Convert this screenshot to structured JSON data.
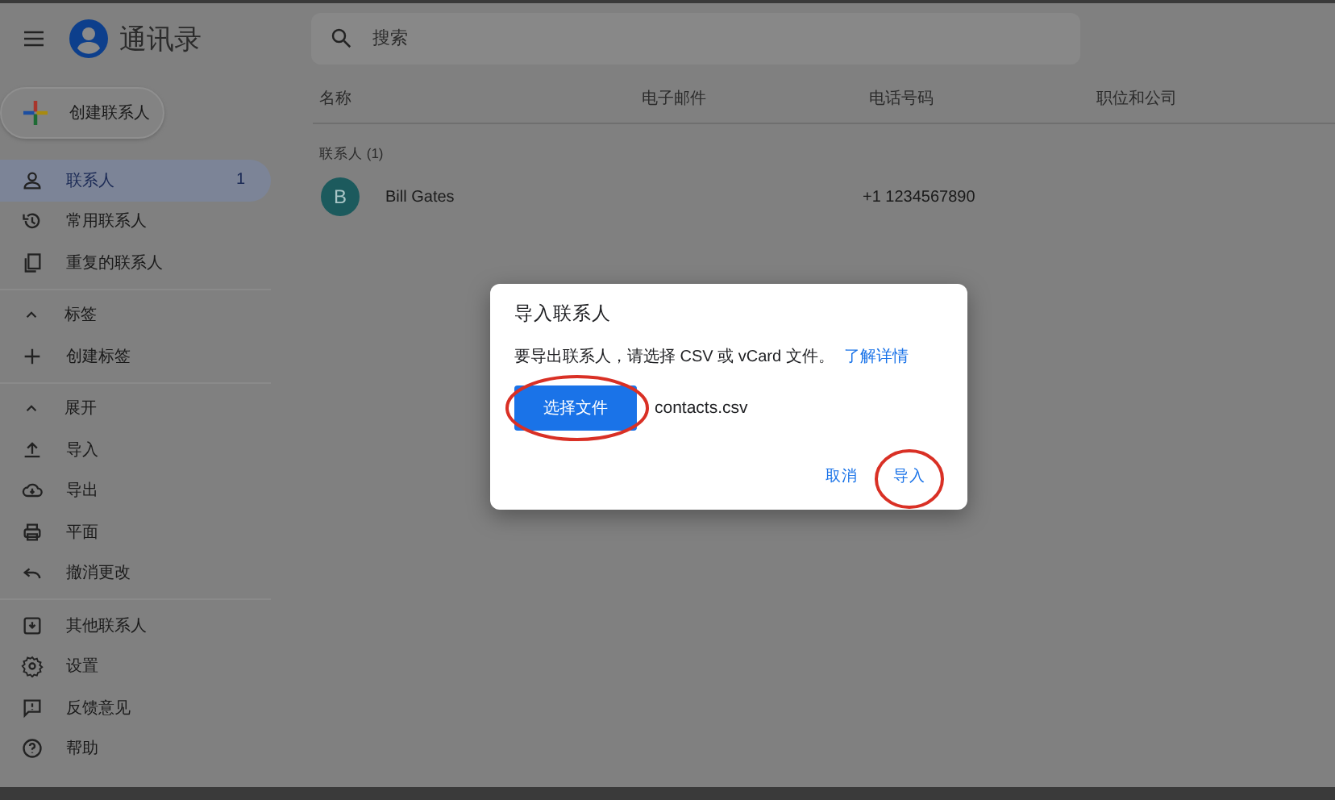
{
  "app": {
    "title": "通讯录"
  },
  "search": {
    "placeholder": "搜索"
  },
  "create_button": {
    "label": "创建联系人"
  },
  "sidebar": {
    "groups": [
      {
        "items": [
          {
            "label": "联系人",
            "count": "1",
            "selected": true
          },
          {
            "label": "常用联系人",
            "selected": false
          },
          {
            "label": "重复的联系人",
            "selected": false
          }
        ]
      },
      {
        "header": {
          "label": "标签",
          "expanded": true
        },
        "items": [
          {
            "label": "创建标签",
            "selected": false
          }
        ]
      },
      {
        "header": {
          "label": "展开",
          "expanded": true
        },
        "items": [
          {
            "label": "导入",
            "selected": false
          },
          {
            "label": "导出",
            "selected": false
          },
          {
            "label": "平面",
            "selected": false
          },
          {
            "label": "撤消更改",
            "selected": false
          }
        ]
      },
      {
        "items": [
          {
            "label": "其他联系人",
            "selected": false
          },
          {
            "label": "设置",
            "selected": false
          },
          {
            "label": "反馈意见",
            "selected": false
          },
          {
            "label": "帮助",
            "selected": false
          }
        ]
      }
    ]
  },
  "table": {
    "columns": [
      "名称",
      "电子邮件",
      "电话号码",
      "职位和公司"
    ],
    "section_label": "联系人 (1)",
    "rows": [
      {
        "initial": "B",
        "name": "Bill Gates",
        "email": "",
        "phone": "+1 1234567890",
        "company": ""
      }
    ]
  },
  "dialog": {
    "title": "导入联系人",
    "message": "要导出联系人，请选择 CSV 或 vCard 文件。",
    "link": "了解详情",
    "choose_button": {
      "label": "选择文件",
      "highlighted": true
    },
    "file_name": "contacts.csv",
    "buttons": [
      {
        "label": "取消",
        "highlighted": false
      },
      {
        "label": "导入",
        "highlighted": true
      }
    ]
  }
}
